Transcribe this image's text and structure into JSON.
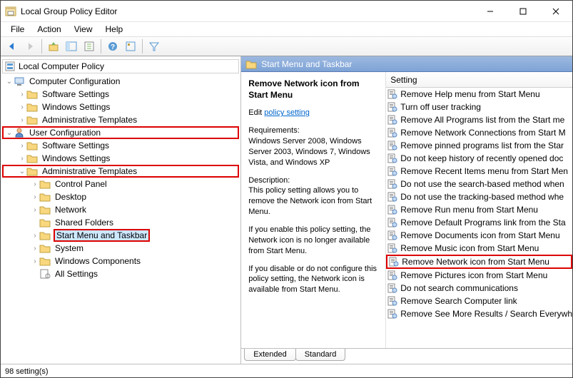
{
  "window": {
    "title": "Local Group Policy Editor"
  },
  "menu": {
    "file": "File",
    "action": "Action",
    "view": "View",
    "help": "Help"
  },
  "tree": {
    "header": "Local Computer Policy",
    "comp_conf": "Computer Configuration",
    "sw": "Software Settings",
    "win": "Windows Settings",
    "admin": "Administrative Templates",
    "user_conf": "User Configuration",
    "cp": "Control Panel",
    "desktop": "Desktop",
    "network": "Network",
    "shared": "Shared Folders",
    "start": "Start Menu and Taskbar",
    "system": "System",
    "wincomp": "Windows Components",
    "allset": "All Settings"
  },
  "right": {
    "header": "Start Menu and Taskbar",
    "setting_col": "Setting",
    "desc_title": "Remove Network icon from Start Menu",
    "edit": "Edit",
    "policy_link": "policy setting",
    "req_label": "Requirements:",
    "req_text": "Windows Server 2008, Windows Server 2003, Windows 7, Windows Vista, and Windows XP",
    "desc_label": "Description:",
    "desc_text1": "This policy setting allows you to remove the Network icon from Start Menu.",
    "desc_text2": "If you enable this policy setting, the Network icon is no longer available from Start Menu.",
    "desc_text3": "If you disable or do not configure this policy setting, the Network icon is available from Start Menu.",
    "settings": [
      "Remove Help menu from Start Menu",
      "Turn off user tracking",
      "Remove All Programs list from the Start me",
      "Remove Network Connections from Start M",
      "Remove pinned programs list from the Star",
      "Do not keep history of recently opened doc",
      "Remove Recent Items menu from Start Men",
      "Do not use the search-based method when",
      "Do not use the tracking-based method whe",
      "Remove Run menu from Start Menu",
      "Remove Default Programs link from the Sta",
      "Remove Documents icon from Start Menu",
      "Remove Music icon from Start Menu",
      "Remove Network icon from Start Menu",
      "Remove Pictures icon from Start Menu",
      "Do not search communications",
      "Remove Search Computer link",
      "Remove See More Results / Search Everywh"
    ]
  },
  "tabs": {
    "ext": "Extended",
    "std": "Standard"
  },
  "status": {
    "text": "98 setting(s)"
  }
}
